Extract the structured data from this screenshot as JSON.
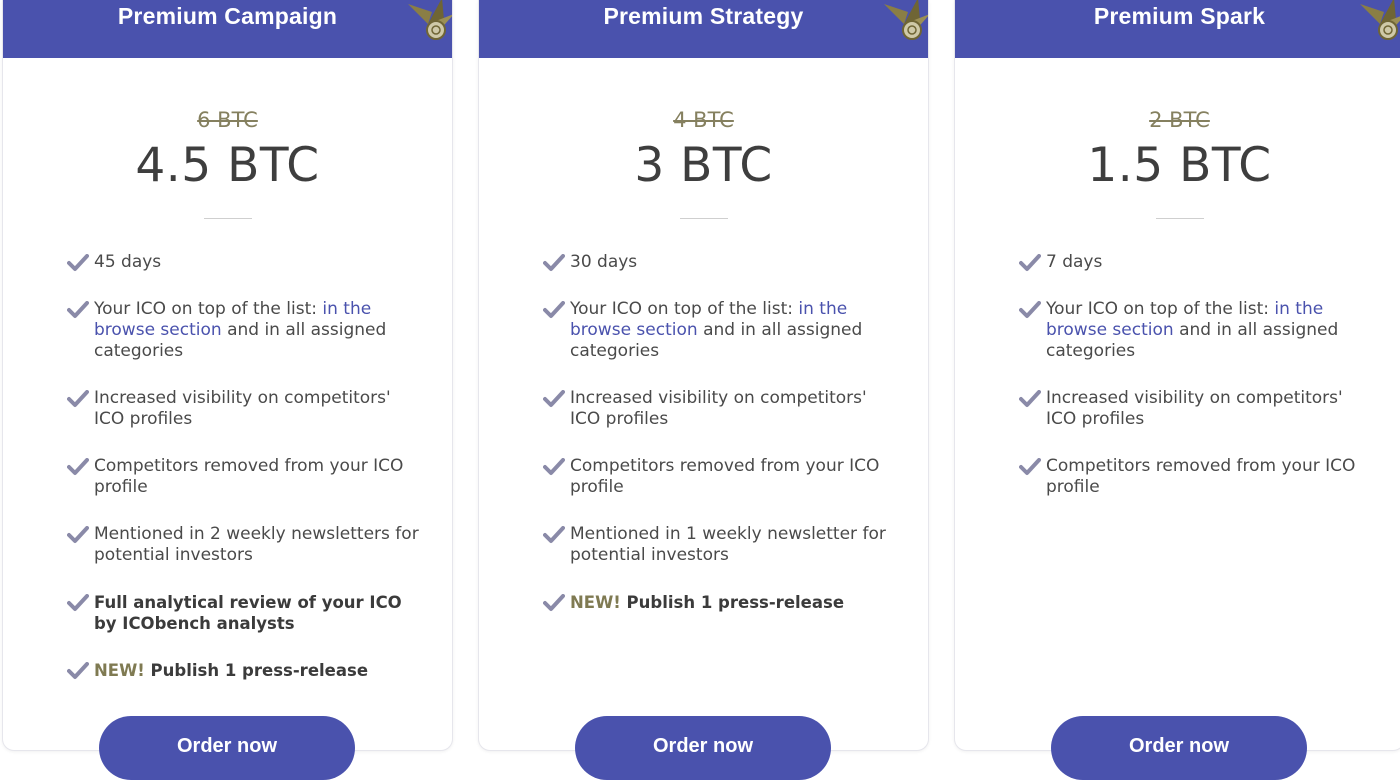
{
  "plans": [
    {
      "name": "Premium Campaign",
      "old_price": "6 BTC",
      "price": "4.5 BTC",
      "features": [
        {
          "text": "45 days"
        },
        {
          "prefix": "Your ICO on top of the list: ",
          "link": "in the browse section",
          "suffix": " and in all assigned categories"
        },
        {
          "text": "Increased visibility on competitors' ICO profiles"
        },
        {
          "text": "Competitors removed from your ICO profile"
        },
        {
          "text": "Mentioned in 2 weekly newsletters for potential investors"
        },
        {
          "text": "Full analytical review of your ICO by ICObench analysts",
          "bold": true
        },
        {
          "tag": "NEW!",
          "text": " Publish 1 press-release",
          "bold": true
        }
      ],
      "button": "Order now"
    },
    {
      "name": "Premium Strategy",
      "old_price": "4 BTC",
      "price": "3 BTC",
      "features": [
        {
          "text": "30 days"
        },
        {
          "prefix": "Your ICO on top of the list: ",
          "link": "in the browse section",
          "suffix": " and in all assigned categories"
        },
        {
          "text": "Increased visibility on competitors' ICO profiles"
        },
        {
          "text": "Competitors removed from your ICO profile"
        },
        {
          "text": "Mentioned in 1 weekly newsletter for potential investors"
        },
        {
          "tag": "NEW!",
          "text": " Publish 1 press-release",
          "bold": true
        }
      ],
      "button": "Order now"
    },
    {
      "name": "Premium Spark",
      "old_price": "2 BTC",
      "price": "1.5 BTC",
      "features": [
        {
          "text": "7 days"
        },
        {
          "prefix": "Your ICO on top of the list: ",
          "link": "in the browse section",
          "suffix": " and in all assigned categories"
        },
        {
          "text": "Increased visibility on competitors' ICO profiles"
        },
        {
          "text": "Competitors removed from your ICO profile"
        }
      ],
      "button": "Order now"
    }
  ],
  "colors": {
    "header": "#4a52ad",
    "button": "#4a52ad",
    "link": "#4a52ad",
    "old_price": "#85805f",
    "new_tag": "#7f7a52",
    "check": "#8a8aa8"
  },
  "icons": {
    "check": "check-icon",
    "header_decoration": "leaf-icon"
  }
}
